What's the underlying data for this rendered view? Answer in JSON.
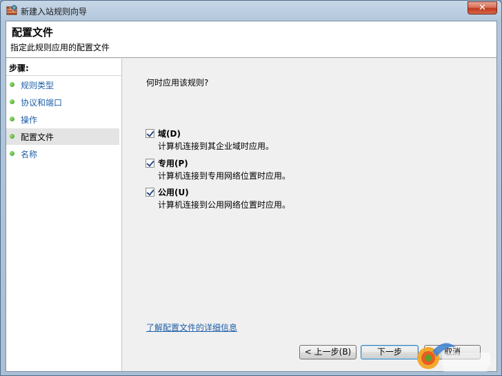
{
  "window": {
    "title": "新建入站规则向导",
    "close_label": "✕"
  },
  "header": {
    "title": "配置文件",
    "subtitle": "指定此规则应用的配置文件"
  },
  "steps": {
    "heading": "步骤:",
    "items": [
      {
        "label": "规则类型"
      },
      {
        "label": "协议和端口"
      },
      {
        "label": "操作"
      },
      {
        "label": "配置文件"
      },
      {
        "label": "名称"
      }
    ]
  },
  "main": {
    "question": "何时应用该规则?",
    "options": [
      {
        "label": "域(D)",
        "description": "计算机连接到其企业域时应用。",
        "checked": true
      },
      {
        "label": "专用(P)",
        "description": "计算机连接到专用网络位置时应用。",
        "checked": true
      },
      {
        "label": "公用(U)",
        "description": "计算机连接到公用网络位置时应用。",
        "checked": true
      }
    ],
    "learn_more_link": "了解配置文件的详细信息"
  },
  "buttons": {
    "prev": "< 上一步(B)",
    "next": "下一步",
    "cancel": "取消"
  },
  "colors": {
    "link": "#1f5fa8",
    "step_dot": "#2f9a16",
    "close_button": "#c0391f"
  }
}
